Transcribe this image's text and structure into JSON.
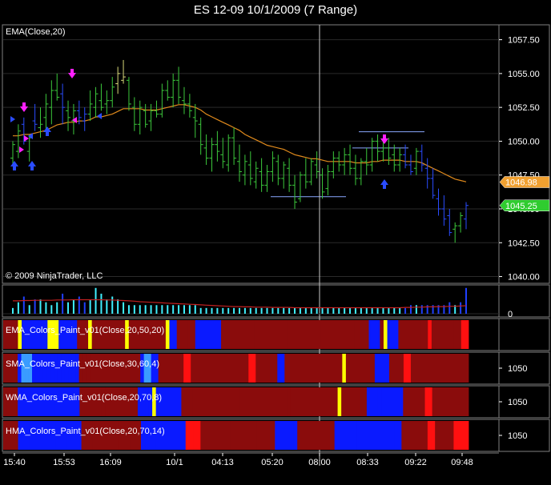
{
  "window": {
    "title": "ES 12-09  10/1/2009 (7 Range)"
  },
  "colors": {
    "background": "#000000",
    "panel_border": "#808080",
    "grid": "#2a2a2a",
    "up_bar": "#3cc83c",
    "up_bar_alt": "#d8d87a",
    "down_bar": "#2a4cff",
    "ema_line": "#e08a1c",
    "ema_badge": "#f0a030",
    "price_badge": "#2fcc2f",
    "cursor": "#c8c8c8",
    "volume_cyan": "#3ff0ff",
    "volume_blue": "#2040ff",
    "volume_avg": "#c02020",
    "paint_yellow": "#ffff00",
    "paint_blue": "#0a1aff",
    "paint_lightblue": "#3a9cff",
    "paint_darkred": "#8a0c0c",
    "paint_red": "#ff1010",
    "arrow_magenta": "#ff20ff",
    "arrow_blue": "#2a4cff",
    "level_line": "#8aa8ff"
  },
  "price_panel": {
    "indicator_label": "EMA(Close,20)",
    "copyright": "© 2009 NinjaTrader, LLC",
    "y_ticks": [
      "1057.50",
      "1055.00",
      "1052.50",
      "1050.00",
      "1047.50",
      "1045.00",
      "1042.50",
      "1040.00"
    ],
    "ema_badge": "1046.98",
    "price_badge": "1045.25"
  },
  "volume_panel": {
    "zero_label": "0"
  },
  "paint_panels": [
    {
      "label": "EMA_Colors_Paint_v01(Close,20,50,20)",
      "value": ""
    },
    {
      "label": "SMA_Colors_Paint_v01(Close,30,60,4)",
      "value": "1050"
    },
    {
      "label": "WMA_Colors_Paint_v01(Close,20,70,8)",
      "value": "1050"
    },
    {
      "label": "HMA_Colors_Paint_v01(Close,20,70,14)",
      "value": "1050"
    }
  ],
  "x_axis": {
    "labels": [
      "15:40",
      "15:53",
      "16:09",
      "10/1",
      "04:13",
      "05:20",
      "08:00",
      "08:33",
      "09:22",
      "09:48"
    ]
  },
  "chart_data": {
    "type": "bar",
    "title": "ES 12-09  10/1/2009 (7 Range)",
    "ylim": [
      1039.5,
      1058.6
    ],
    "bars": [
      {
        "o": 1048.75,
        "h": 1050.0,
        "l": 1048.25,
        "c": 1049.75,
        "d": 0
      },
      {
        "o": 1049.25,
        "h": 1051.25,
        "l": 1048.75,
        "c": 1050.75,
        "d": 0
      },
      {
        "o": 1051.25,
        "h": 1051.75,
        "l": 1049.75,
        "c": 1050.0,
        "d": 1
      },
      {
        "o": 1049.25,
        "h": 1050.5,
        "l": 1048.5,
        "c": 1050.25,
        "d": 0
      },
      {
        "o": 1051.5,
        "h": 1052.75,
        "l": 1050.75,
        "c": 1051.25,
        "d": 1
      },
      {
        "o": 1051.0,
        "h": 1052.5,
        "l": 1050.25,
        "c": 1051.25,
        "d": 0
      },
      {
        "o": 1051.75,
        "h": 1053.5,
        "l": 1050.75,
        "c": 1052.75,
        "d": 0
      },
      {
        "o": 1052.5,
        "h": 1054.5,
        "l": 1051.25,
        "c": 1053.75,
        "d": 0
      },
      {
        "o": 1053.75,
        "h": 1055.0,
        "l": 1053.0,
        "c": 1053.25,
        "d": 0
      },
      {
        "o": 1053.5,
        "h": 1054.25,
        "l": 1051.25,
        "c": 1052.5,
        "d": 1
      },
      {
        "o": 1052.25,
        "h": 1053.0,
        "l": 1050.75,
        "c": 1051.75,
        "d": 0
      },
      {
        "o": 1051.5,
        "h": 1052.75,
        "l": 1050.5,
        "c": 1052.25,
        "d": 0
      },
      {
        "o": 1052.25,
        "h": 1053.0,
        "l": 1051.25,
        "c": 1051.75,
        "d": 1
      },
      {
        "o": 1051.5,
        "h": 1052.5,
        "l": 1050.75,
        "c": 1052.0,
        "d": 1
      },
      {
        "o": 1052.0,
        "h": 1053.75,
        "l": 1051.5,
        "c": 1052.75,
        "d": 0
      },
      {
        "o": 1052.5,
        "h": 1054.0,
        "l": 1051.75,
        "c": 1053.5,
        "d": 0
      },
      {
        "o": 1053.0,
        "h": 1054.25,
        "l": 1052.25,
        "c": 1052.5,
        "d": 0
      },
      {
        "o": 1052.75,
        "h": 1053.75,
        "l": 1052.0,
        "c": 1053.0,
        "d": 0
      },
      {
        "o": 1053.0,
        "h": 1054.75,
        "l": 1052.5,
        "c": 1054.0,
        "d": 0
      },
      {
        "o": 1054.25,
        "h": 1055.5,
        "l": 1053.5,
        "c": 1055.0,
        "d": 4
      },
      {
        "o": 1054.5,
        "h": 1056.0,
        "l": 1054.25,
        "c": 1054.75,
        "d": 4
      },
      {
        "o": 1054.5,
        "h": 1054.75,
        "l": 1052.25,
        "c": 1052.75,
        "d": 0
      },
      {
        "o": 1052.5,
        "h": 1053.25,
        "l": 1050.75,
        "c": 1051.25,
        "d": 0
      },
      {
        "o": 1051.25,
        "h": 1053.0,
        "l": 1050.5,
        "c": 1052.5,
        "d": 0
      },
      {
        "o": 1052.25,
        "h": 1052.75,
        "l": 1051.0,
        "c": 1051.25,
        "d": 0
      },
      {
        "o": 1051.5,
        "h": 1052.75,
        "l": 1050.75,
        "c": 1052.25,
        "d": 0
      },
      {
        "o": 1052.25,
        "h": 1053.0,
        "l": 1051.75,
        "c": 1052.0,
        "d": 0
      },
      {
        "o": 1052.0,
        "h": 1054.25,
        "l": 1051.75,
        "c": 1053.75,
        "d": 0
      },
      {
        "o": 1053.75,
        "h": 1054.5,
        "l": 1053.0,
        "c": 1053.25,
        "d": 0
      },
      {
        "o": 1053.25,
        "h": 1055.0,
        "l": 1052.5,
        "c": 1054.5,
        "d": 0
      },
      {
        "o": 1054.5,
        "h": 1055.5,
        "l": 1052.75,
        "c": 1053.25,
        "d": 0
      },
      {
        "o": 1053.0,
        "h": 1054.0,
        "l": 1052.0,
        "c": 1052.75,
        "d": 0
      },
      {
        "o": 1052.75,
        "h": 1053.5,
        "l": 1051.75,
        "c": 1052.25,
        "d": 0
      },
      {
        "o": 1051.75,
        "h": 1052.75,
        "l": 1050.25,
        "c": 1051.5,
        "d": 0
      },
      {
        "o": 1051.25,
        "h": 1051.75,
        "l": 1049.0,
        "c": 1049.75,
        "d": 0
      },
      {
        "o": 1049.5,
        "h": 1050.5,
        "l": 1048.25,
        "c": 1048.75,
        "d": 0
      },
      {
        "o": 1048.75,
        "h": 1050.25,
        "l": 1047.75,
        "c": 1049.75,
        "d": 0
      },
      {
        "o": 1049.75,
        "h": 1050.75,
        "l": 1048.5,
        "c": 1049.25,
        "d": 0
      },
      {
        "o": 1049.0,
        "h": 1050.25,
        "l": 1048.0,
        "c": 1048.5,
        "d": 0
      },
      {
        "o": 1048.25,
        "h": 1050.5,
        "l": 1047.75,
        "c": 1050.25,
        "d": 0
      },
      {
        "o": 1050.25,
        "h": 1051.0,
        "l": 1048.25,
        "c": 1048.75,
        "d": 0
      },
      {
        "o": 1048.5,
        "h": 1049.75,
        "l": 1047.0,
        "c": 1047.75,
        "d": 0
      },
      {
        "o": 1047.5,
        "h": 1049.0,
        "l": 1046.75,
        "c": 1048.5,
        "d": 0
      },
      {
        "o": 1048.25,
        "h": 1049.25,
        "l": 1046.75,
        "c": 1047.25,
        "d": 0
      },
      {
        "o": 1047.0,
        "h": 1048.5,
        "l": 1046.5,
        "c": 1048.0,
        "d": 0
      },
      {
        "o": 1047.75,
        "h": 1048.75,
        "l": 1046.25,
        "c": 1046.75,
        "d": 0
      },
      {
        "o": 1046.75,
        "h": 1048.25,
        "l": 1046.25,
        "c": 1047.75,
        "d": 0
      },
      {
        "o": 1047.75,
        "h": 1049.25,
        "l": 1047.0,
        "c": 1048.75,
        "d": 0
      },
      {
        "o": 1048.5,
        "h": 1049.0,
        "l": 1046.75,
        "c": 1047.25,
        "d": 0
      },
      {
        "o": 1047.25,
        "h": 1048.5,
        "l": 1046.5,
        "c": 1048.25,
        "d": 0
      },
      {
        "o": 1048.0,
        "h": 1048.75,
        "l": 1046.25,
        "c": 1046.75,
        "d": 0
      },
      {
        "o": 1046.75,
        "h": 1047.5,
        "l": 1045.0,
        "c": 1045.5,
        "d": 0
      },
      {
        "o": 1045.75,
        "h": 1047.75,
        "l": 1045.5,
        "c": 1047.5,
        "d": 0
      },
      {
        "o": 1047.5,
        "h": 1048.75,
        "l": 1046.5,
        "c": 1047.0,
        "d": 0
      },
      {
        "o": 1047.0,
        "h": 1048.75,
        "l": 1046.75,
        "c": 1048.5,
        "d": 0
      },
      {
        "o": 1048.25,
        "h": 1049.25,
        "l": 1047.25,
        "c": 1047.75,
        "d": 0
      },
      {
        "o": 1047.5,
        "h": 1048.0,
        "l": 1045.75,
        "c": 1046.25,
        "d": 0
      },
      {
        "o": 1046.5,
        "h": 1048.25,
        "l": 1046.0,
        "c": 1047.75,
        "d": 0
      },
      {
        "o": 1047.75,
        "h": 1049.25,
        "l": 1047.25,
        "c": 1048.75,
        "d": 0
      },
      {
        "o": 1048.75,
        "h": 1049.25,
        "l": 1047.75,
        "c": 1048.25,
        "d": 0
      },
      {
        "o": 1048.25,
        "h": 1049.5,
        "l": 1047.5,
        "c": 1049.0,
        "d": 0
      },
      {
        "o": 1049.0,
        "h": 1049.75,
        "l": 1047.5,
        "c": 1048.0,
        "d": 0
      },
      {
        "o": 1048.0,
        "h": 1049.0,
        "l": 1046.75,
        "c": 1047.25,
        "d": 0
      },
      {
        "o": 1047.25,
        "h": 1048.75,
        "l": 1046.75,
        "c": 1048.5,
        "d": 0
      },
      {
        "o": 1048.5,
        "h": 1049.5,
        "l": 1047.5,
        "c": 1048.25,
        "d": 0
      },
      {
        "o": 1048.25,
        "h": 1050.25,
        "l": 1047.75,
        "c": 1050.0,
        "d": 0
      },
      {
        "o": 1050.0,
        "h": 1050.5,
        "l": 1048.5,
        "c": 1049.25,
        "d": 0
      },
      {
        "o": 1049.25,
        "h": 1050.0,
        "l": 1048.5,
        "c": 1049.5,
        "d": 0
      },
      {
        "o": 1049.5,
        "h": 1050.25,
        "l": 1048.25,
        "c": 1048.75,
        "d": 0
      },
      {
        "o": 1049.0,
        "h": 1049.75,
        "l": 1047.75,
        "c": 1048.25,
        "d": 0
      },
      {
        "o": 1048.25,
        "h": 1049.5,
        "l": 1047.75,
        "c": 1049.0,
        "d": 0
      },
      {
        "o": 1049.0,
        "h": 1049.75,
        "l": 1048.0,
        "c": 1048.25,
        "d": 1
      },
      {
        "o": 1048.25,
        "h": 1049.0,
        "l": 1047.5,
        "c": 1047.75,
        "d": 1
      },
      {
        "o": 1048.0,
        "h": 1049.5,
        "l": 1047.5,
        "c": 1049.25,
        "d": 0
      },
      {
        "o": 1049.25,
        "h": 1049.75,
        "l": 1047.75,
        "c": 1048.25,
        "d": 1
      },
      {
        "o": 1048.0,
        "h": 1048.75,
        "l": 1046.5,
        "c": 1047.25,
        "d": 1
      },
      {
        "o": 1047.25,
        "h": 1048.0,
        "l": 1045.75,
        "c": 1046.0,
        "d": 1
      },
      {
        "o": 1045.75,
        "h": 1046.5,
        "l": 1044.5,
        "c": 1045.0,
        "d": 1
      },
      {
        "o": 1045.0,
        "h": 1046.0,
        "l": 1043.75,
        "c": 1044.25,
        "d": 1
      },
      {
        "o": 1044.5,
        "h": 1045.0,
        "l": 1043.0,
        "c": 1043.25,
        "d": 1
      },
      {
        "o": 1043.5,
        "h": 1044.0,
        "l": 1042.5,
        "c": 1043.75,
        "d": 0
      },
      {
        "o": 1043.75,
        "h": 1044.75,
        "l": 1043.25,
        "c": 1044.5,
        "d": 0
      },
      {
        "o": 1044.25,
        "h": 1045.5,
        "l": 1043.5,
        "c": 1045.25,
        "d": 1
      }
    ],
    "ema": [
      1050.4,
      1050.4,
      1050.5,
      1050.5,
      1050.6,
      1050.7,
      1050.8,
      1051.0,
      1051.2,
      1051.3,
      1051.4,
      1051.4,
      1051.5,
      1051.5,
      1051.6,
      1051.8,
      1051.8,
      1051.9,
      1052.0,
      1052.2,
      1052.4,
      1052.4,
      1052.4,
      1052.4,
      1052.3,
      1052.3,
      1052.3,
      1052.4,
      1052.5,
      1052.6,
      1052.7,
      1052.7,
      1052.6,
      1052.5,
      1052.3,
      1052.0,
      1051.8,
      1051.6,
      1051.4,
      1051.2,
      1051.0,
      1050.8,
      1050.5,
      1050.3,
      1050.1,
      1049.9,
      1049.7,
      1049.6,
      1049.5,
      1049.4,
      1049.2,
      1049.0,
      1048.9,
      1048.8,
      1048.7,
      1048.7,
      1048.6,
      1048.5,
      1048.5,
      1048.5,
      1048.5,
      1048.5,
      1048.4,
      1048.4,
      1048.4,
      1048.5,
      1048.5,
      1048.6,
      1048.6,
      1048.6,
      1048.6,
      1048.5,
      1048.5,
      1048.5,
      1048.4,
      1048.2,
      1048.0,
      1047.8,
      1047.6,
      1047.4,
      1047.2,
      1047.1,
      1047.0
    ],
    "volume": [
      2,
      4,
      6,
      3,
      5,
      5,
      4,
      3,
      4,
      7,
      4,
      5,
      6,
      4,
      5,
      9,
      7,
      5,
      6,
      5,
      4,
      3,
      3,
      3,
      3,
      3,
      3,
      3,
      3,
      3,
      3,
      3,
      3,
      3,
      2,
      2,
      2,
      2,
      2,
      2,
      2,
      2,
      2,
      2,
      2,
      2,
      2,
      2,
      2,
      2,
      2,
      2,
      2,
      2,
      2,
      2,
      2,
      2,
      2,
      2,
      2,
      2,
      2,
      2,
      2,
      2,
      2,
      2,
      2,
      2,
      2,
      2,
      3,
      3,
      3,
      3,
      3,
      3,
      3,
      4,
      3,
      4,
      9
    ],
    "volume_avg": [
      4.5,
      4.5,
      4.6,
      4.6,
      4.7,
      4.7,
      4.7,
      4.7,
      4.8,
      4.8,
      4.8,
      4.9,
      4.9,
      4.9,
      4.9,
      4.9,
      4.9,
      4.8,
      4.8,
      4.7,
      4.6,
      4.5,
      4.4,
      4.2,
      4.1,
      4.0,
      3.9,
      3.8,
      3.7,
      3.6,
      3.5,
      3.4,
      3.3,
      3.2,
      3.1,
      3.0,
      2.9,
      2.8,
      2.7,
      2.6,
      2.5,
      2.5,
      2.4,
      2.4,
      2.3,
      2.3,
      2.3,
      2.2,
      2.2,
      2.2,
      2.2,
      2.1,
      2.1,
      2.1,
      2.1,
      2.1,
      2.1,
      2.1,
      2.1,
      2.1,
      2.1,
      2.1,
      2.1,
      2.1,
      2.1,
      2.1,
      2.1,
      2.1,
      2.1,
      2.1,
      2.1,
      2.2,
      2.2,
      2.3,
      2.3,
      2.4,
      2.4,
      2.5,
      2.5,
      2.6,
      2.6,
      2.7,
      2.8
    ],
    "paint_rows": [
      "RRRRYBBBBBBBYYYBBBBBRRRYRRRRRRRRRYRRRRRRRRRRYBBRRRRRBBBBBBBRRRRRRRRRRRRRRRRRRRRRRRRRRRRRRRRRRRRRRRRBBBRYBBBRRRRRRRRSRRRRRRRRSS",
      "RRRRBLLLBBBBBBBBBBBBBRRRRRRRRRRRRRRRRRBLLBBRRRRRRRSSRRRRRRRRRRRRRRRRSSRRRRRRBBRRRRRRRRRRRRRRRRYRRRRRRRRBBBBRRRRSSRRRRRRRRRRRRRRRR",
      "RRRRBBBBBBBBBBBBBBBBBRRRRRRRRRRRRRRRRBBBBYBBBBBBBRRRRRRRRRRRRRRRRRRRRRRRRRRRRRRRRRRRRRRRRRRRYRRRRRRRBBBBBBBBBBRRRRRRSSRRRRRRRRRR",
      "RRRRBBBBBBBBBBBBBBBBBRRRRRRRRRRRRRRRRBBBBBBBBBBBBSSSSRRRRRRRRRRRRRRRRRRRRBBBBBBRRRRRRRRRRBBBBBBBBBBBBBBBBBBRRRRRRRSSRRRRRSSSS"
    ]
  }
}
